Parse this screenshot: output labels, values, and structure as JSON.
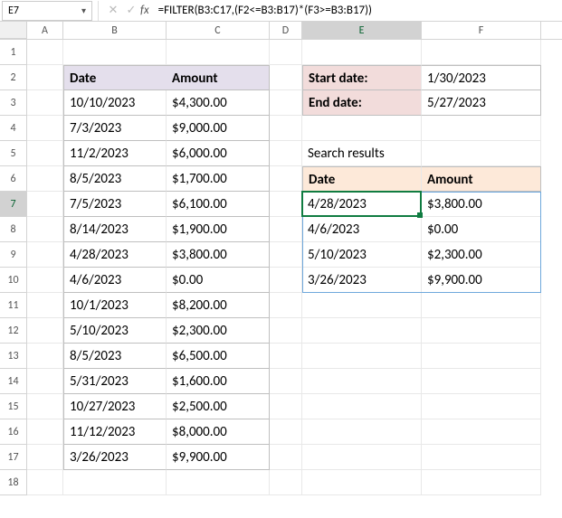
{
  "nameBox": "E7",
  "formula": "=FILTER(B3:C17,(F2<=B3:B17)*(F3>=B3:B17))",
  "cols": [
    "A",
    "B",
    "C",
    "D",
    "E",
    "F"
  ],
  "rows": [
    "1",
    "2",
    "3",
    "4",
    "5",
    "6",
    "7",
    "8",
    "9",
    "10",
    "11",
    "12",
    "13",
    "14",
    "15",
    "16",
    "17",
    "18"
  ],
  "mainTable": {
    "headers": {
      "date": "Date",
      "amount": "Amount"
    },
    "rows": [
      {
        "date": "10/10/2023",
        "amount": "$4,300.00"
      },
      {
        "date": "7/3/2023",
        "amount": "$9,000.00"
      },
      {
        "date": "11/2/2023",
        "amount": "$6,000.00"
      },
      {
        "date": "8/5/2023",
        "amount": "$1,700.00"
      },
      {
        "date": "7/5/2023",
        "amount": "$6,100.00"
      },
      {
        "date": "8/14/2023",
        "amount": "$1,900.00"
      },
      {
        "date": "4/28/2023",
        "amount": "$3,800.00"
      },
      {
        "date": "4/6/2023",
        "amount": "$0.00"
      },
      {
        "date": "10/1/2023",
        "amount": "$8,200.00"
      },
      {
        "date": "5/10/2023",
        "amount": "$2,300.00"
      },
      {
        "date": "8/5/2023",
        "amount": "$6,500.00"
      },
      {
        "date": "5/31/2023",
        "amount": "$1,600.00"
      },
      {
        "date": "10/27/2023",
        "amount": "$2,500.00"
      },
      {
        "date": "11/12/2023",
        "amount": "$8,000.00"
      },
      {
        "date": "3/26/2023",
        "amount": "$9,900.00"
      }
    ]
  },
  "criteria": {
    "startLabel": "Start date:",
    "endLabel": "End date:",
    "startValue": "1/30/2023",
    "endValue": "5/27/2023"
  },
  "results": {
    "title": "Search results",
    "headers": {
      "date": "Date",
      "amount": "Amount"
    },
    "rows": [
      {
        "date": "4/28/2023",
        "amount": "$3,800.00"
      },
      {
        "date": "4/6/2023",
        "amount": "$0.00"
      },
      {
        "date": "5/10/2023",
        "amount": "$2,300.00"
      },
      {
        "date": "3/26/2023",
        "amount": "$9,900.00"
      }
    ]
  }
}
